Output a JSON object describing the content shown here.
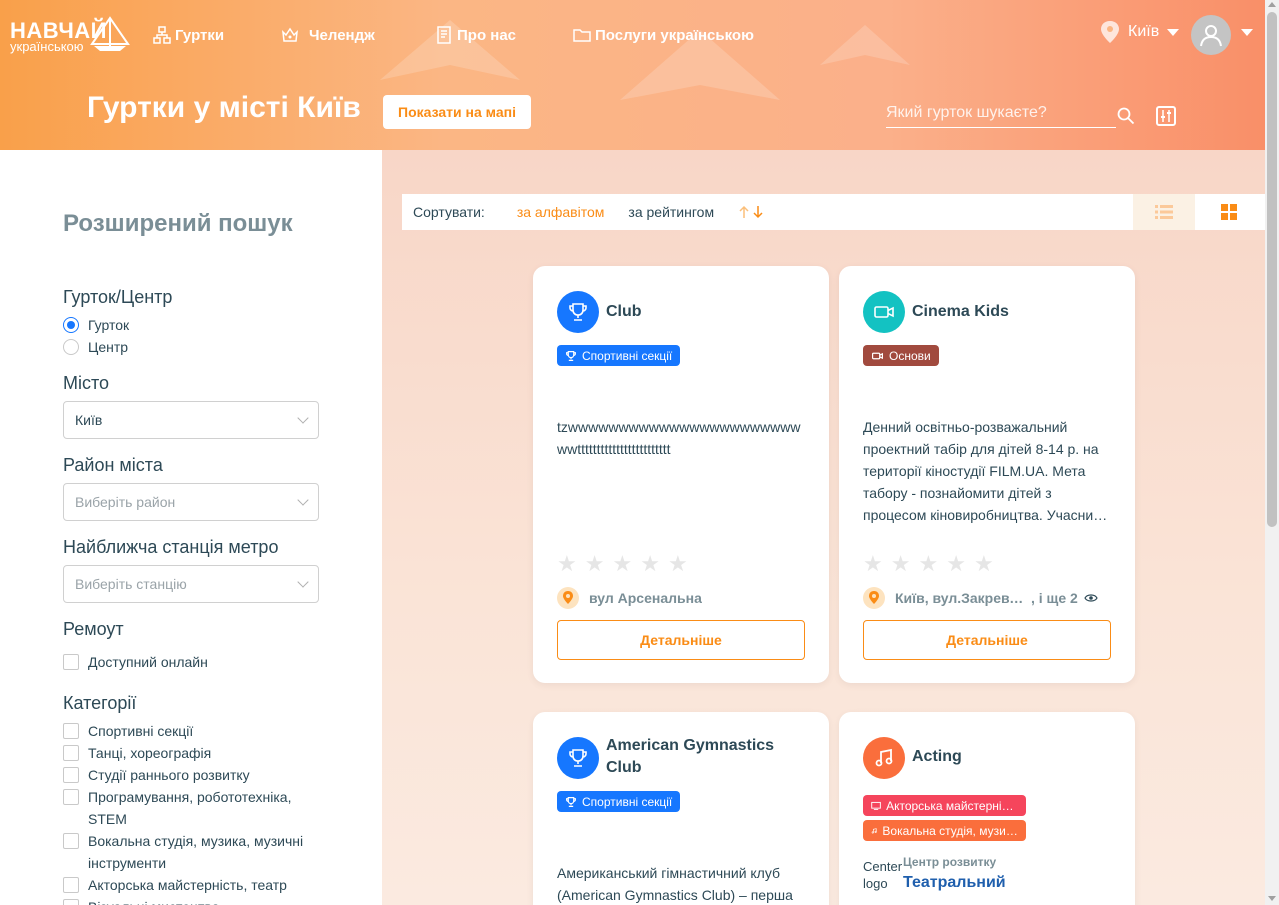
{
  "logo": {
    "line1": "НАВЧАЙ",
    "line2": "українською"
  },
  "nav": [
    {
      "label": "Гуртки",
      "icon": "clubs-icon"
    },
    {
      "label": "Челендж",
      "icon": "challenge-icon"
    },
    {
      "label": "Про нас",
      "icon": "about-icon"
    },
    {
      "label": "Послуги українською",
      "icon": "folder-icon"
    }
  ],
  "header": {
    "city": "Київ",
    "title": "Гуртки у місті Київ",
    "map_button": "Показати на мапі",
    "search_placeholder": "Який гурток шукаєте?"
  },
  "sidebar": {
    "title": "Розширений пошук",
    "type_label": "Гурток/Центр",
    "type_options": [
      "Гурток",
      "Центр"
    ],
    "type_selected": "Гурток",
    "city_label": "Місто",
    "city_value": "Київ",
    "district_label": "Район міста",
    "district_placeholder": "Виберіть район",
    "metro_label": "Найближча станція метро",
    "metro_placeholder": "Виберіть станцію",
    "remote_label": "Ремоут",
    "remote_option": "Доступний онлайн",
    "categories_label": "Категорії",
    "categories": [
      "Спортивні секції",
      "Танці, хореографія",
      "Студії раннього розвитку",
      "Програмування, робототехніка, STEM",
      "Вокальна студія, музика, музичні інструменти",
      "Акторська майстерність, театр",
      "Візуальні мистецтва"
    ]
  },
  "sort": {
    "label": "Сортувати:",
    "by_alpha": "за алфавітом",
    "by_rating": "за рейтингом",
    "active": "за алфавітом"
  },
  "cards": [
    {
      "title": "Club",
      "icon": "trophy-icon",
      "color": "#1677ff",
      "tags": [
        {
          "label": "Спортивні секції",
          "color": "#1677ff",
          "icon": "trophy-icon"
        }
      ],
      "description": "tzwwwwwwwwwwwwwwwwwwwwwwwwwtttttttttttttttttttttttt",
      "rating": 0,
      "address": "вул Арсенальна",
      "address_more": "",
      "button": "Детальніше"
    },
    {
      "title": "Cinema Kids",
      "icon": "video-icon",
      "color": "#13c2c2",
      "tags": [
        {
          "label": "Основи",
          "color": "#a14a3e",
          "icon": "video-icon"
        }
      ],
      "description": "Денний освітньо-розважальний проектний табір для дітей 8-14 р. на території кіностудії FILM.UA. Мета табору - познайомити дітей з процесом кіновиробництва. Учасни…",
      "rating": 0,
      "address": "Київ, вул.Закревського",
      "address_more": ", і ще 2",
      "button": "Детальніше"
    },
    {
      "title": "American Gymnastics Club",
      "icon": "trophy-icon",
      "color": "#1677ff",
      "tags": [
        {
          "label": "Спортивні секції",
          "color": "#1677ff",
          "icon": "trophy-icon"
        }
      ],
      "description": "Американський гімнастичний клуб (American Gymnastics Club) – перша",
      "button": "Детальніше"
    },
    {
      "title": "Acting",
      "icon": "music-icon",
      "color": "#fa6e3c",
      "tags": [
        {
          "label": "Акторська майстерність, театр",
          "color": "#f5455c",
          "icon": "theater-icon"
        },
        {
          "label": "Вокальна студія, музика, музичні інструменти",
          "color": "#fa6e3c",
          "icon": "music-icon"
        }
      ],
      "center_label": "Центр розвитку",
      "center_name": "Театральний",
      "center_logo_alt": "Center logo"
    }
  ]
}
